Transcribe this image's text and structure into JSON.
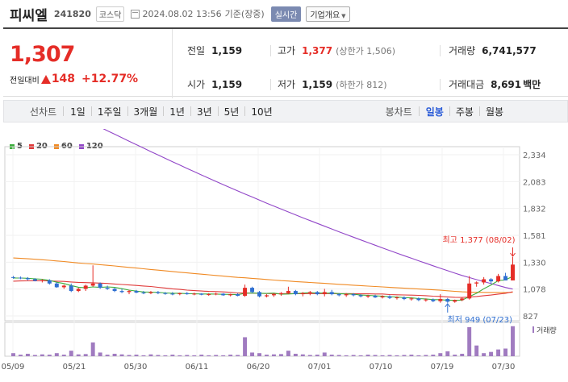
{
  "header": {
    "stock_name": "피씨엘",
    "stock_code": "241820",
    "market": "코스닥",
    "date": "2024.08.02 13:56",
    "basis": "기준(장중)",
    "realtime_label": "실시간",
    "company_label": "기업개요"
  },
  "quote": {
    "price": "1,307",
    "change_label": "전일대비",
    "change": "148",
    "change_pct": "+12.77%",
    "prev_close": {
      "label": "전일",
      "value": "1,159"
    },
    "high": {
      "label": "고가",
      "value": "1,377",
      "sub": "(상한가 1,506)"
    },
    "volume": {
      "label": "거래량",
      "value": "6,741,577"
    },
    "open": {
      "label": "시가",
      "value": "1,159"
    },
    "low": {
      "label": "저가",
      "value": "1,159",
      "sub": "(하한가 812)"
    },
    "amount": {
      "label": "거래대금",
      "value": "8,691",
      "unit": "백만"
    }
  },
  "periods": {
    "line_label": "선차트",
    "line_items": [
      "1일",
      "1주일",
      "3개월",
      "1년",
      "3년",
      "5년",
      "10년"
    ],
    "candle_label": "봉차트",
    "candle_items": [
      "일봉",
      "주봉",
      "월봉"
    ],
    "active": "일봉"
  },
  "legend": [
    {
      "label": "5",
      "color": "#3cae3c"
    },
    {
      "label": "20",
      "color": "#e03a3a"
    },
    {
      "label": "60",
      "color": "#f08a24"
    },
    {
      "label": "120",
      "color": "#9146c8"
    }
  ],
  "colors": {
    "up": "#e52d27",
    "down": "#2f6fd1",
    "ma5": "#3cae3c",
    "ma20": "#e03a3a",
    "ma60": "#f08a24",
    "ma120": "#9146c8",
    "volume": "#a07bc0"
  },
  "chart_data": {
    "type": "candlestick",
    "y_ticks": [
      "2,334",
      "2,083",
      "1,832",
      "1,581",
      "1,330",
      "1,078",
      "827"
    ],
    "ylim": [
      827,
      2334
    ],
    "x_ticks": [
      "05/09",
      "05/21",
      "05/30",
      "06/11",
      "06/20",
      "07/01",
      "07/10",
      "07/19",
      "07/30"
    ],
    "volume_label": "거래량",
    "annotations": {
      "high": "최고 1,377 (08/02)",
      "low": "최저 949 (07/23)"
    },
    "candles": [
      [
        1190,
        1200,
        1175,
        1185
      ],
      [
        1185,
        1195,
        1170,
        1180
      ],
      [
        1180,
        1190,
        1160,
        1170
      ],
      [
        1170,
        1180,
        1150,
        1155
      ],
      [
        1155,
        1170,
        1140,
        1160
      ],
      [
        1160,
        1170,
        1120,
        1130
      ],
      [
        1130,
        1140,
        1090,
        1095
      ],
      [
        1095,
        1120,
        1080,
        1110
      ],
      [
        1110,
        1130,
        1050,
        1060
      ],
      [
        1060,
        1090,
        1050,
        1080
      ],
      [
        1080,
        1120,
        1060,
        1110
      ],
      [
        1110,
        1300,
        1100,
        1130
      ],
      [
        1130,
        1140,
        1080,
        1090
      ],
      [
        1090,
        1110,
        1070,
        1080
      ],
      [
        1080,
        1090,
        1050,
        1060
      ],
      [
        1060,
        1080,
        1040,
        1050
      ],
      [
        1050,
        1070,
        1030,
        1060
      ],
      [
        1060,
        1070,
        1040,
        1045
      ],
      [
        1045,
        1060,
        1030,
        1040
      ],
      [
        1040,
        1060,
        1030,
        1050
      ],
      [
        1050,
        1060,
        1030,
        1040
      ],
      [
        1040,
        1050,
        1025,
        1035
      ],
      [
        1035,
        1050,
        1020,
        1030
      ],
      [
        1030,
        1045,
        1020,
        1040
      ],
      [
        1040,
        1050,
        1025,
        1030
      ],
      [
        1030,
        1045,
        1020,
        1035
      ],
      [
        1035,
        1040,
        1020,
        1025
      ],
      [
        1025,
        1040,
        1015,
        1030
      ],
      [
        1030,
        1045,
        1020,
        1035
      ],
      [
        1035,
        1040,
        1015,
        1020
      ],
      [
        1020,
        1035,
        1010,
        1030
      ],
      [
        1030,
        1040,
        1010,
        1015
      ],
      [
        1015,
        1120,
        1005,
        1090
      ],
      [
        1090,
        1100,
        1040,
        1050
      ],
      [
        1050,
        1060,
        1000,
        1010
      ],
      [
        1010,
        1030,
        1000,
        1020
      ],
      [
        1020,
        1040,
        1005,
        1030
      ],
      [
        1030,
        1050,
        1015,
        1040
      ],
      [
        1040,
        1100,
        1030,
        1060
      ],
      [
        1060,
        1070,
        1020,
        1030
      ],
      [
        1030,
        1050,
        1010,
        1040
      ],
      [
        1040,
        1060,
        1020,
        1050
      ],
      [
        1050,
        1060,
        1020,
        1030
      ],
      [
        1030,
        1080,
        1010,
        1050
      ],
      [
        1050,
        1070,
        1020,
        1030
      ],
      [
        1030,
        1040,
        1010,
        1020
      ],
      [
        1020,
        1040,
        1005,
        1030
      ],
      [
        1030,
        1040,
        1010,
        1020
      ],
      [
        1020,
        1030,
        1000,
        1010
      ],
      [
        1010,
        1025,
        995,
        1015
      ],
      [
        1015,
        1025,
        995,
        1000
      ],
      [
        1000,
        1020,
        990,
        1010
      ],
      [
        1010,
        1020,
        985,
        995
      ],
      [
        995,
        1010,
        980,
        1000
      ],
      [
        1000,
        1010,
        975,
        985
      ],
      [
        985,
        1000,
        970,
        990
      ],
      [
        990,
        1000,
        965,
        975
      ],
      [
        975,
        990,
        960,
        980
      ],
      [
        980,
        990,
        955,
        965
      ],
      [
        965,
        1030,
        950,
        985
      ],
      [
        985,
        995,
        949,
        960
      ],
      [
        960,
        980,
        950,
        975
      ],
      [
        975,
        1000,
        965,
        990
      ],
      [
        990,
        1200,
        980,
        1130
      ],
      [
        1130,
        1150,
        1100,
        1140
      ],
      [
        1140,
        1190,
        1120,
        1170
      ],
      [
        1170,
        1180,
        1130,
        1150
      ],
      [
        1150,
        1220,
        1140,
        1200
      ],
      [
        1200,
        1230,
        1160,
        1159
      ],
      [
        1159,
        1377,
        1159,
        1307
      ]
    ],
    "volumes": [
      0.1,
      0.05,
      0.08,
      0.04,
      0.06,
      0.05,
      0.1,
      0.05,
      0.18,
      0.06,
      0.07,
      0.45,
      0.12,
      0.05,
      0.08,
      0.06,
      0.04,
      0.05,
      0.03,
      0.06,
      0.04,
      0.03,
      0.05,
      0.03,
      0.04,
      0.03,
      0.05,
      0.03,
      0.04,
      0.03,
      0.05,
      0.04,
      0.62,
      0.12,
      0.1,
      0.05,
      0.06,
      0.07,
      0.18,
      0.08,
      0.06,
      0.04,
      0.05,
      0.12,
      0.05,
      0.04,
      0.03,
      0.04,
      0.03,
      0.05,
      0.04,
      0.03,
      0.04,
      0.03,
      0.04,
      0.05,
      0.03,
      0.04,
      0.05,
      0.1,
      0.16,
      0.05,
      0.08,
      0.95,
      0.35,
      0.1,
      0.14,
      0.22,
      0.25,
      0.98
    ]
  }
}
